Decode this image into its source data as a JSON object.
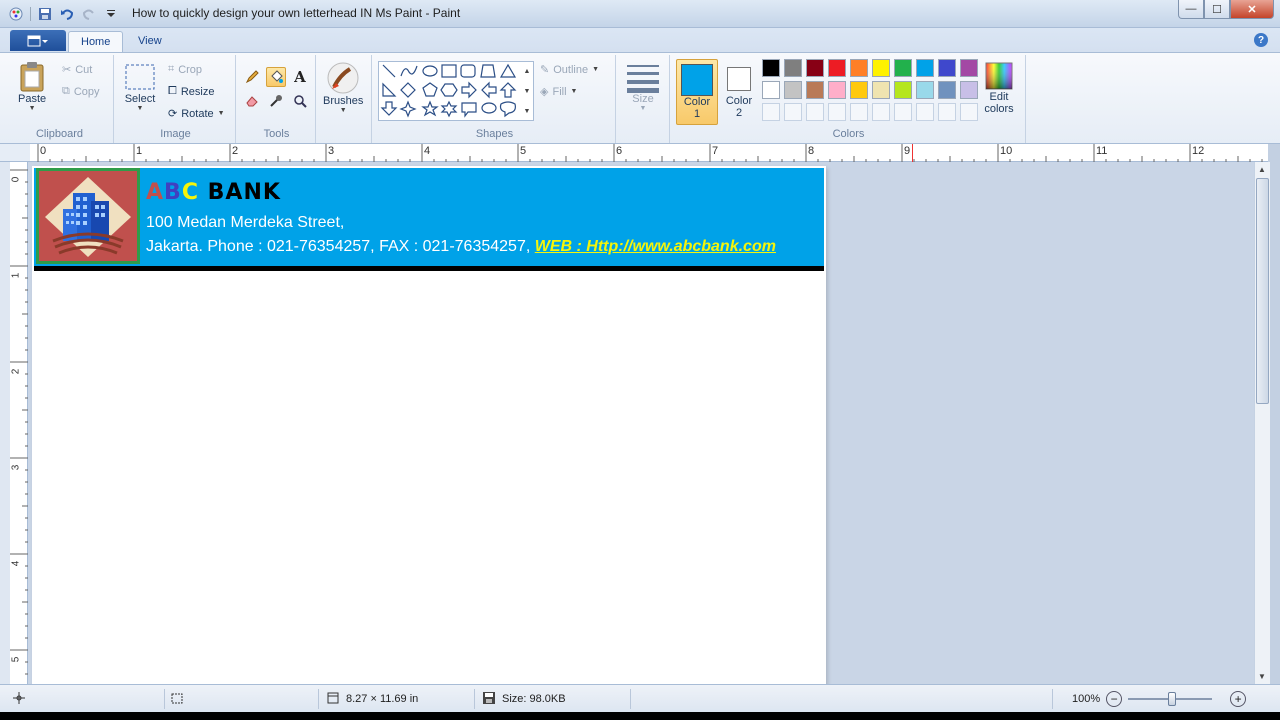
{
  "window": {
    "title": "How to quickly design your own letterhead IN Ms Paint - Paint",
    "minimize": "—",
    "maximize": "☐",
    "close": "✕"
  },
  "tabs": [
    {
      "label": "Home"
    },
    {
      "label": "View"
    }
  ],
  "help": "?",
  "ribbon": {
    "clipboard": {
      "label": "Clipboard",
      "paste": "Paste",
      "cut": "Cut",
      "copy": "Copy"
    },
    "image": {
      "label": "Image",
      "select": "Select",
      "crop": "Crop",
      "resize": "Resize",
      "rotate": "Rotate"
    },
    "tools": {
      "label": "Tools",
      "text_glyph": "A"
    },
    "brushes": {
      "label": "Brushes"
    },
    "shapes": {
      "label": "Shapes",
      "outline": "Outline",
      "fill": "Fill"
    },
    "size": {
      "label": "Size"
    },
    "colors": {
      "label": "Colors",
      "color1": {
        "line1": "Color",
        "line2": "1",
        "value": "#00a2e8"
      },
      "color2": {
        "line1": "Color",
        "line2": "2",
        "value": "#ffffff"
      },
      "edit": {
        "line1": "Edit",
        "line2": "colors"
      },
      "palette_row1": [
        "#000000",
        "#7f7f7f",
        "#880015",
        "#ed1c24",
        "#ff7f27",
        "#fff200",
        "#22b14c",
        "#00a2e8",
        "#3f48cc",
        "#a349a4"
      ],
      "palette_row2": [
        "#ffffff",
        "#c3c3c3",
        "#b97a57",
        "#ffaec9",
        "#ffc90e",
        "#efe4b0",
        "#b5e61d",
        "#99d9ea",
        "#7092be",
        "#c8bfe7"
      ]
    }
  },
  "ruler": {
    "h_numbers": [
      "0",
      "1",
      "2",
      "3",
      "4",
      "5",
      "6",
      "7",
      "8",
      "9",
      "10",
      "11",
      "12"
    ],
    "v_numbers": [
      "0",
      "1",
      "2",
      "3",
      "4",
      "5"
    ]
  },
  "letterhead": {
    "bank_letters": [
      {
        "ch": "A",
        "color": "#c0504d"
      },
      {
        "ch": "B",
        "color": "#4040c0"
      },
      {
        "ch": "C",
        "color": "#f5f50a"
      },
      {
        "ch": " ",
        "color": "#000"
      },
      {
        "ch": "B",
        "color": "#000"
      },
      {
        "ch": "A",
        "color": "#000"
      },
      {
        "ch": "N",
        "color": "#000"
      },
      {
        "ch": "K",
        "color": "#000"
      }
    ],
    "address_line1": "100 Medan Merdeka Street,",
    "address_line2": "Jakarta. Phone : 021-76354257, FAX : 021-76354257,",
    "web": "WEB : Http://www.abcbank.com"
  },
  "status": {
    "size_dims": "8.27 × 11.69 in",
    "file_size": "Size: 98.0KB",
    "zoom": "100%"
  }
}
